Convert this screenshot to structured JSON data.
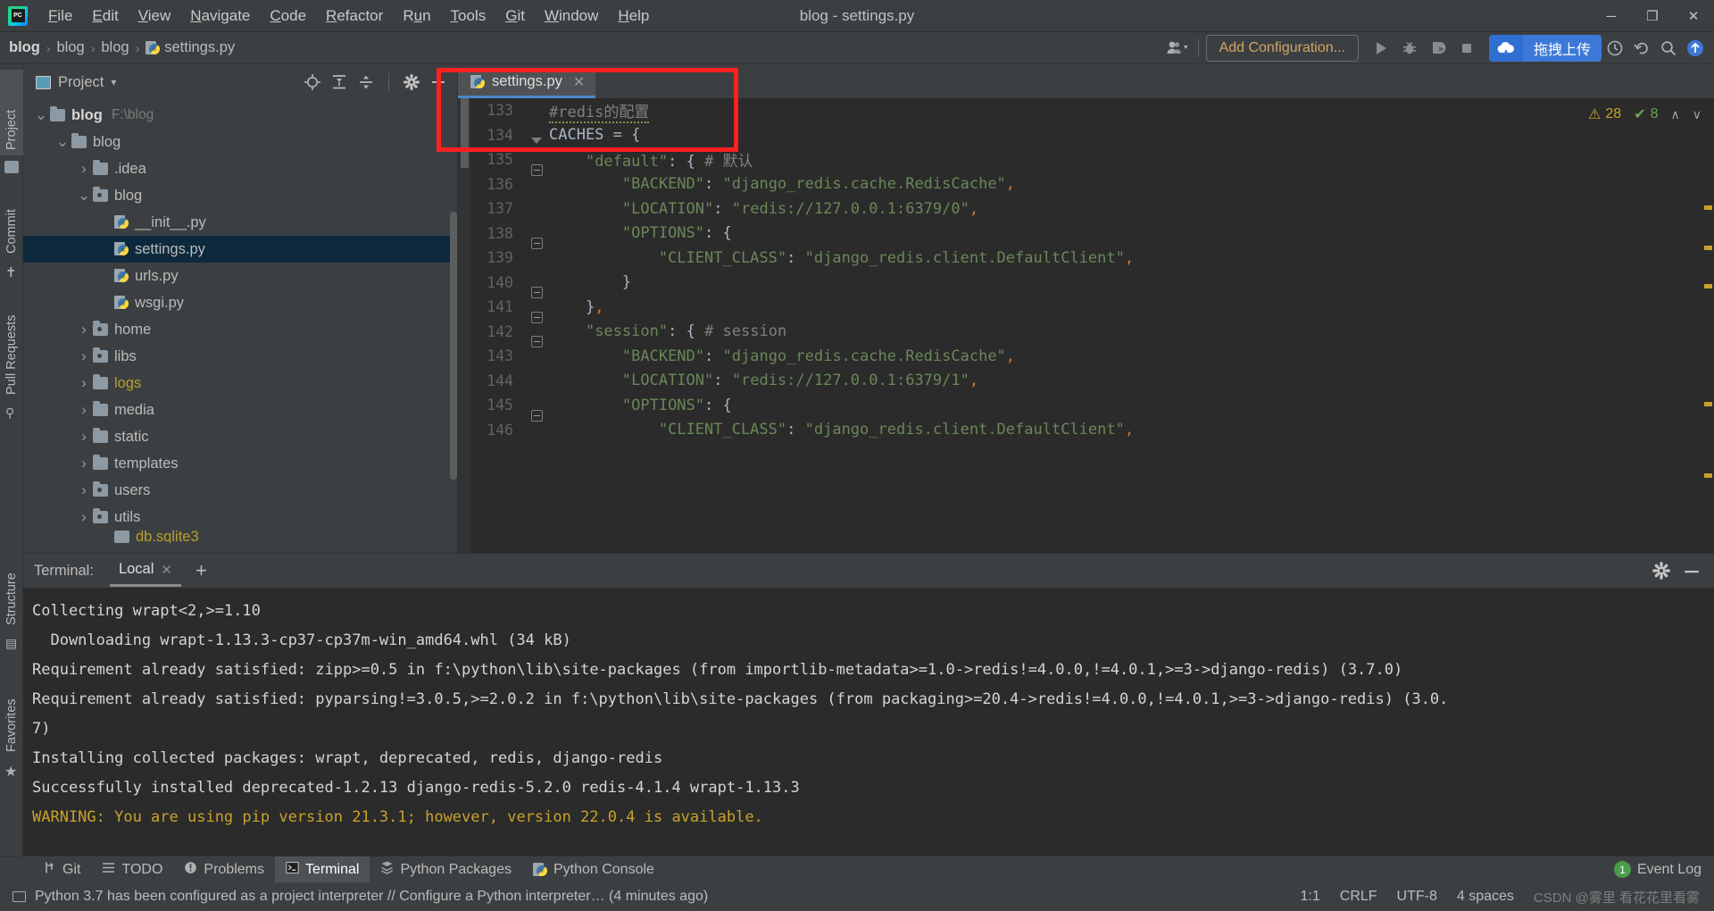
{
  "window": {
    "title": "blog - settings.py",
    "app_icon": "pycharm-logo",
    "controls": {
      "minimize": "─",
      "maximize": "❐",
      "close": "✕"
    }
  },
  "menu": [
    {
      "label": "File",
      "mnemonic": "F"
    },
    {
      "label": "Edit",
      "mnemonic": "E"
    },
    {
      "label": "View",
      "mnemonic": "V"
    },
    {
      "label": "Navigate",
      "mnemonic": "N"
    },
    {
      "label": "Code",
      "mnemonic": "C"
    },
    {
      "label": "Refactor",
      "mnemonic": "R"
    },
    {
      "label": "Run",
      "mnemonic": "u"
    },
    {
      "label": "Tools",
      "mnemonic": "T"
    },
    {
      "label": "Git",
      "mnemonic": "G"
    },
    {
      "label": "Window",
      "mnemonic": "W"
    },
    {
      "label": "Help",
      "mnemonic": "H"
    }
  ],
  "breadcrumb": {
    "items": [
      "blog",
      "blog",
      "blog",
      "settings.py"
    ],
    "separator": "›"
  },
  "toolbar": {
    "add_configuration": "Add Configuration...",
    "run_label": "Run",
    "debug_label": "Debug",
    "coverage_label": "Run with Coverage",
    "stop_label": "Stop",
    "upload_button": "拖拽上传",
    "search_label": "Search Everywhere",
    "updates_label": "Updates"
  },
  "left_strip": [
    {
      "label": "Project",
      "selected": true
    },
    {
      "label": "Commit",
      "selected": false
    },
    {
      "label": "Pull Requests",
      "selected": false
    }
  ],
  "left_strip_bottom": [
    {
      "label": "Structure"
    },
    {
      "label": "Favorites"
    }
  ],
  "project_panel": {
    "title": "Project",
    "dropdown": "▾",
    "actions": [
      "locate-icon",
      "expand-all-icon",
      "collapse-all-icon",
      "settings-gear-icon",
      "hide-icon"
    ],
    "tree": [
      {
        "indent": 0,
        "arrow": "⌄",
        "icon": "folder",
        "label": "blog",
        "bold": true,
        "path": "F:\\blog"
      },
      {
        "indent": 1,
        "arrow": "⌄",
        "icon": "folder",
        "label": "blog",
        "bold": false,
        "path": ""
      },
      {
        "indent": 2,
        "arrow": "›",
        "icon": "folder",
        "label": ".idea",
        "bold": false,
        "path": ""
      },
      {
        "indent": 2,
        "arrow": "⌄",
        "icon": "folder-module",
        "label": "blog",
        "bold": false,
        "path": ""
      },
      {
        "indent": 3,
        "arrow": "",
        "icon": "python-file",
        "label": "__init__.py",
        "bold": false,
        "path": ""
      },
      {
        "indent": 3,
        "arrow": "",
        "icon": "python-file",
        "label": "settings.py",
        "bold": false,
        "path": "",
        "selected": true
      },
      {
        "indent": 3,
        "arrow": "",
        "icon": "python-file",
        "label": "urls.py",
        "bold": false,
        "path": ""
      },
      {
        "indent": 3,
        "arrow": "",
        "icon": "python-file",
        "label": "wsgi.py",
        "bold": false,
        "path": ""
      },
      {
        "indent": 2,
        "arrow": "›",
        "icon": "folder-module",
        "label": "home",
        "bold": false,
        "path": ""
      },
      {
        "indent": 2,
        "arrow": "›",
        "icon": "folder-module",
        "label": "libs",
        "bold": false,
        "path": ""
      },
      {
        "indent": 2,
        "arrow": "›",
        "icon": "folder",
        "label": "logs",
        "bold": false,
        "path": "",
        "color": "yellow"
      },
      {
        "indent": 2,
        "arrow": "›",
        "icon": "folder",
        "label": "media",
        "bold": false,
        "path": ""
      },
      {
        "indent": 2,
        "arrow": "›",
        "icon": "folder",
        "label": "static",
        "bold": false,
        "path": ""
      },
      {
        "indent": 2,
        "arrow": "›",
        "icon": "folder",
        "label": "templates",
        "bold": false,
        "path": ""
      },
      {
        "indent": 2,
        "arrow": "›",
        "icon": "folder-module",
        "label": "users",
        "bold": false,
        "path": ""
      },
      {
        "indent": 2,
        "arrow": "›",
        "icon": "folder-module",
        "label": "utils",
        "bold": false,
        "path": ""
      },
      {
        "indent": 3,
        "arrow": "",
        "icon": "db-file",
        "label": "db.sqlite3",
        "bold": false,
        "path": "",
        "color": "yellow",
        "clipped": true
      }
    ]
  },
  "editor": {
    "tab": {
      "label": "settings.py",
      "icon": "python-file",
      "close": "✕"
    },
    "inspections": {
      "warnings": "28",
      "warning_icon": "⚠",
      "checks": "8",
      "check_icon": "✔",
      "up": "∧",
      "down": "∨"
    },
    "lines": [
      {
        "no": "133",
        "fold": "",
        "text": "#redis的配置",
        "kind": "comment"
      },
      {
        "no": "134",
        "fold": "tri",
        "text": "CACHES = {",
        "kind": "code"
      },
      {
        "no": "135",
        "fold": "box",
        "text": "    \"default\": { # 默认",
        "kind": "code"
      },
      {
        "no": "136",
        "fold": "",
        "text": "        \"BACKEND\": \"django_redis.cache.RedisCache\",",
        "kind": "code"
      },
      {
        "no": "137",
        "fold": "",
        "text": "        \"LOCATION\": \"redis://127.0.0.1:6379/0\",",
        "kind": "code"
      },
      {
        "no": "138",
        "fold": "box",
        "text": "        \"OPTIONS\": {",
        "kind": "code"
      },
      {
        "no": "139",
        "fold": "",
        "text": "            \"CLIENT_CLASS\": \"django_redis.client.DefaultClient\",",
        "kind": "code"
      },
      {
        "no": "140",
        "fold": "end",
        "text": "        }",
        "kind": "code"
      },
      {
        "no": "141",
        "fold": "end",
        "text": "    },",
        "kind": "code"
      },
      {
        "no": "142",
        "fold": "box",
        "text": "    \"session\": { # session",
        "kind": "code"
      },
      {
        "no": "143",
        "fold": "",
        "text": "        \"BACKEND\": \"django_redis.cache.RedisCache\",",
        "kind": "code"
      },
      {
        "no": "144",
        "fold": "",
        "text": "        \"LOCATION\": \"redis://127.0.0.1:6379/1\",",
        "kind": "code"
      },
      {
        "no": "145",
        "fold": "box",
        "text": "        \"OPTIONS\": {",
        "kind": "code"
      },
      {
        "no": "146",
        "fold": "",
        "text": "            \"CLIENT_CLASS\": \"django_redis.client.DefaultClient\",",
        "kind": "code"
      }
    ]
  },
  "terminal": {
    "label": "Terminal:",
    "tab": "Local",
    "tab_close": "✕",
    "add": "+",
    "settings_icon": "gear-icon",
    "minimize_icon": "minimize-icon",
    "output": [
      {
        "text": "Collecting wrapt<2,>=1.10",
        "warn": false
      },
      {
        "text": "  Downloading wrapt-1.13.3-cp37-cp37m-win_amd64.whl (34 kB)",
        "warn": false
      },
      {
        "text": "Requirement already satisfied: zipp>=0.5 in f:\\python\\lib\\site-packages (from importlib-metadata>=1.0->redis!=4.0.0,!=4.0.1,>=3->django-redis) (3.7.0)",
        "warn": false
      },
      {
        "text": "Requirement already satisfied: pyparsing!=3.0.5,>=2.0.2 in f:\\python\\lib\\site-packages (from packaging>=20.4->redis!=4.0.0,!=4.0.1,>=3->django-redis) (3.0.",
        "warn": false
      },
      {
        "text": "7)",
        "warn": false
      },
      {
        "text": "Installing collected packages: wrapt, deprecated, redis, django-redis",
        "warn": false
      },
      {
        "text": "Successfully installed deprecated-1.2.13 django-redis-5.2.0 redis-4.1.4 wrapt-1.13.3",
        "warn": false
      },
      {
        "text": "WARNING: You are using pip version 21.3.1; however, version 22.0.4 is available.",
        "warn": true
      }
    ]
  },
  "bottom_tabs": [
    {
      "label": "Git",
      "icon": "git-icon",
      "selected": false
    },
    {
      "label": "TODO",
      "icon": "todo-icon",
      "selected": false
    },
    {
      "label": "Problems",
      "icon": "problems-icon",
      "selected": false
    },
    {
      "label": "Terminal",
      "icon": "terminal-icon",
      "selected": true
    },
    {
      "label": "Python Packages",
      "icon": "packages-icon",
      "selected": false
    },
    {
      "label": "Python Console",
      "icon": "console-icon",
      "selected": false
    }
  ],
  "event_log": {
    "label": "Event Log",
    "count": "1"
  },
  "status_bar": {
    "message": "Python 3.7 has been configured as a project interpreter // Configure a Python interpreter… (4 minutes ago)",
    "caret": "1:1",
    "line_sep": "CRLF",
    "encoding": "UTF-8",
    "indent": "4 spaces",
    "watermark": "CSDN @雾里 看花花里看雾"
  },
  "colors": {
    "accent_blue": "#3c78d8",
    "tab_underline": "#4a88c7",
    "selection": "#0d293e",
    "string_green": "#6a8759",
    "comment_gray": "#808080",
    "warning_yellow": "#c9a22b",
    "annotation_red": "#ff2020"
  }
}
